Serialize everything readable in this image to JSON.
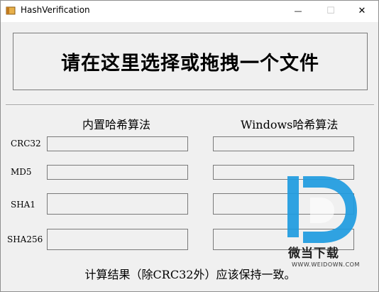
{
  "window": {
    "title": "HashVerification",
    "minimize_glyph": "—",
    "maximize_glyph": "☐",
    "close_glyph": "✕"
  },
  "drop_zone": {
    "label": "请在这里选择或拖拽一个文件"
  },
  "columns": {
    "builtin_header": "内置哈希算法",
    "windows_header": "Windows哈希算法"
  },
  "rows": [
    {
      "label": "CRC32",
      "builtin_value": "",
      "windows_value": ""
    },
    {
      "label": "MD5",
      "builtin_value": "",
      "windows_value": ""
    },
    {
      "label": "SHA1",
      "builtin_value": "",
      "windows_value": ""
    },
    {
      "label": "SHA256",
      "builtin_value": "",
      "windows_value": ""
    }
  ],
  "footer": {
    "note": "计算结果（除CRC32外）应该保持一致。"
  },
  "watermark": {
    "title": "微当下载",
    "url": "WWW.WEIDOWN.COM",
    "color": "#1e9be0"
  },
  "colors": {
    "window_bg": "#f0f0f0",
    "titlebar_bg": "#ffffff",
    "field_border": "#7a7a7a"
  }
}
